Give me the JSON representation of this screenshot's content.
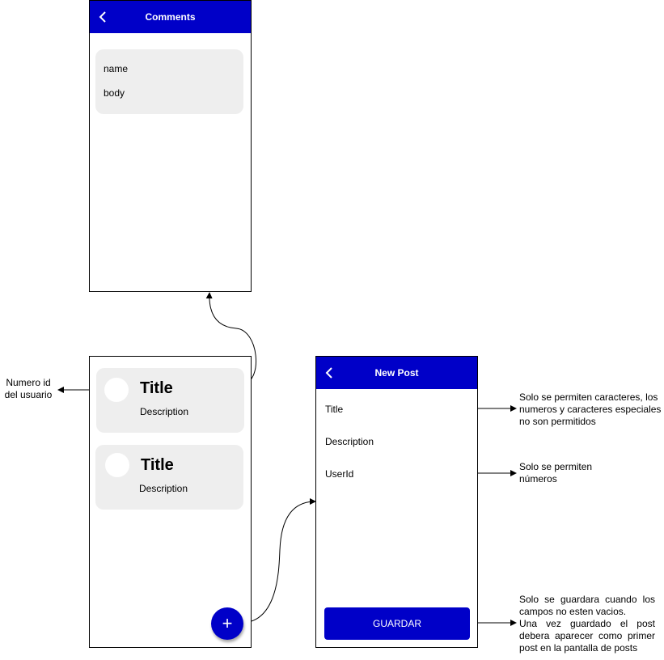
{
  "comments_screen": {
    "title": "Comments",
    "card": {
      "name": "name",
      "body": "body"
    }
  },
  "posts_screen": {
    "cards": [
      {
        "title": "Title",
        "description": "Description"
      },
      {
        "title": "Title",
        "description": "Description"
      }
    ],
    "fab_label": "+"
  },
  "new_post_screen": {
    "title": "New Post",
    "fields": {
      "title": "Title",
      "description": "Description",
      "user_id": "UserId"
    },
    "save_button": "GUARDAR"
  },
  "annotations": {
    "user_id_note_line1": "Numero id",
    "user_id_note_line2": "del usuario",
    "title_rule_line1": "Solo se permiten caracteres, los",
    "title_rule_line2": "numeros y caracteres especiales",
    "title_rule_line3": "no son permitidos",
    "userid_rule_line1": "Solo se permiten",
    "userid_rule_line2": "números",
    "save_rule_line1": "Solo se guardara cuando los",
    "save_rule_line2": "campos no esten vacios.",
    "save_rule_line3": "Una vez guardado el post",
    "save_rule_line4": "debera aparecer como primer",
    "save_rule_line5": "post en la pantalla de posts"
  },
  "colors": {
    "accent": "#0000c8",
    "card_bg": "#eeeeee",
    "line": "#000000"
  },
  "icons": {
    "back": "chevron-left-icon",
    "add": "plus-icon"
  }
}
